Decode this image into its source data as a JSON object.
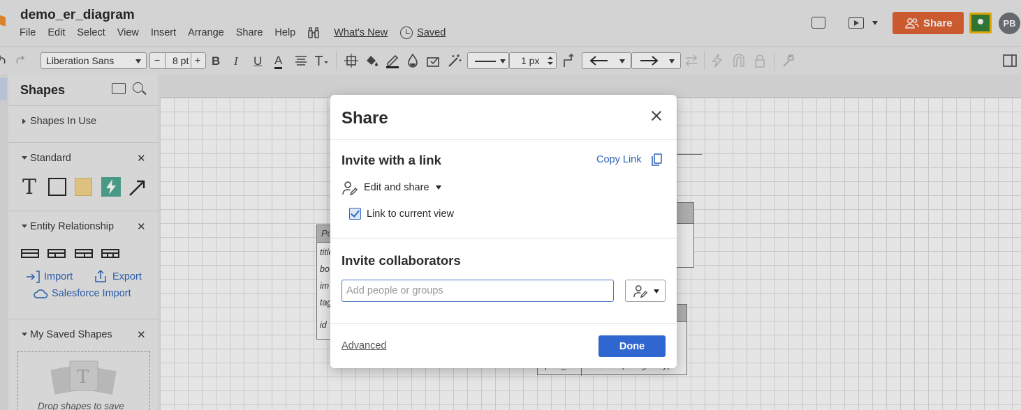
{
  "app": {
    "document_title": "demo_er_diagram"
  },
  "menu": {
    "items": [
      "File",
      "Edit",
      "Select",
      "View",
      "Insert",
      "Arrange",
      "Share",
      "Help"
    ],
    "whats_new": "What's New",
    "saved": "Saved"
  },
  "header": {
    "share_label": "Share",
    "avatar_initials": "PB",
    "accent_color": "#e05f2e"
  },
  "toolbar": {
    "font_family": "Liberation Sans",
    "font_size": "8 pt",
    "minus": "−",
    "plus": "+",
    "bold": "B",
    "italic": "I",
    "underline": "U",
    "text_color": "A",
    "line_width": "1 px"
  },
  "sidebar": {
    "title": "Shapes",
    "sections": {
      "in_use": "Shapes In Use",
      "standard": "Standard",
      "entity_relationship": "Entity Relationship",
      "saved_shapes": "My Saved Shapes"
    },
    "import_label": "Import",
    "export_label": "Export",
    "salesforce_label": "Salesforce Import",
    "drop_text": "Drop shapes to save"
  },
  "canvas": {
    "entity_rows": [
      "title",
      "bo",
      "im",
      "tag",
      "id"
    ],
    "entity_head": "Po",
    "right_entity_fragments": [
      "post_id",
      "number (foreign key)"
    ]
  },
  "share_dialog": {
    "title": "Share",
    "invite_link_heading": "Invite with a link",
    "copy_link": "Copy Link",
    "permission": "Edit and share",
    "link_current_view": "Link to current view",
    "link_current_view_checked": true,
    "invite_collaborators_heading": "Invite collaborators",
    "people_placeholder": "Add people or groups",
    "advanced": "Advanced",
    "done": "Done",
    "primary_color": "#2f66d0"
  }
}
